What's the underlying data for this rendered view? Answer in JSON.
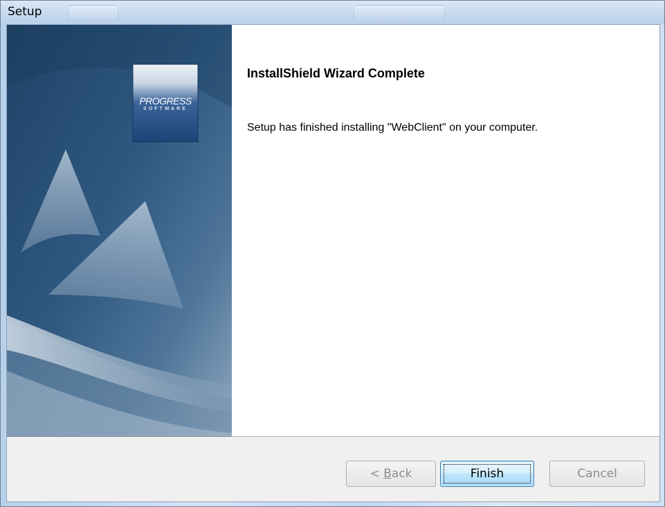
{
  "window": {
    "title": "Setup"
  },
  "banner": {
    "logo_line1": "PROGRESS",
    "logo_line2": "SOFTWARE"
  },
  "content": {
    "heading": "InstallShield Wizard Complete",
    "message": "Setup has finished installing \"WebClient\" on your computer."
  },
  "buttons": {
    "back": {
      "prefix": "< ",
      "mnemonic": "B",
      "rest": "ack",
      "enabled": false
    },
    "finish": {
      "label": "Finish",
      "enabled": true,
      "default": true
    },
    "cancel": {
      "label": "Cancel",
      "enabled": false
    }
  },
  "colors": {
    "banner_dark": "#1f4266",
    "banner_mid": "#3f6a93",
    "banner_light": "#9fb5c9",
    "logo_bg": "#2d5587",
    "default_button_border": "#3c7fb1"
  }
}
